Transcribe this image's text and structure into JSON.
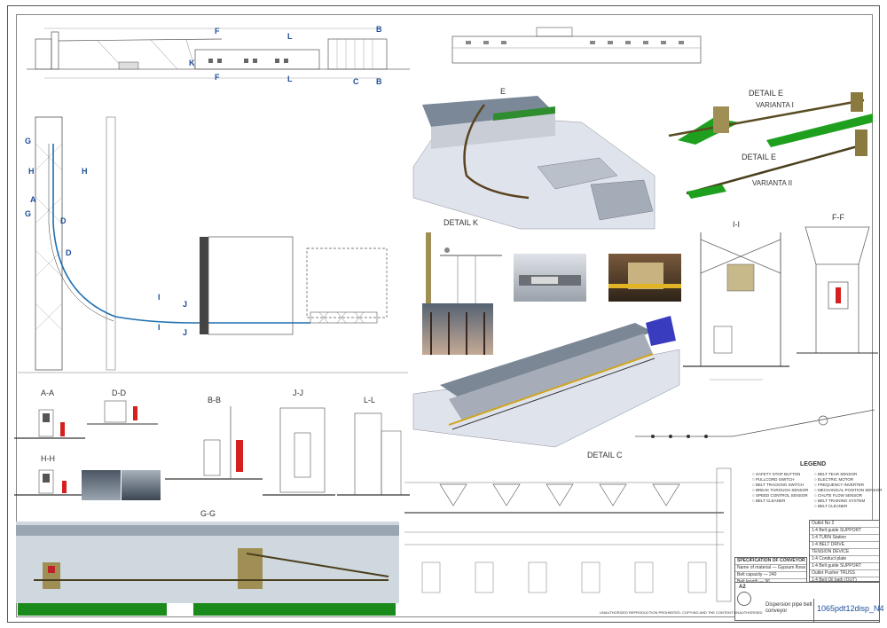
{
  "sheet": {
    "title_line1": "Dispersion pipe belt",
    "title_line2": "conveyor",
    "drawing_no": "1065pdt12disp_N4",
    "sheet_size": "A2"
  },
  "views": {
    "detail_e_3d": "E",
    "detail_e": "DETAIL E",
    "varianta_1": "VARIANTA  I",
    "varianta_2": "VARIANTA  II",
    "detail_e_2": "DETAIL E",
    "detail_k": "DETAIL K",
    "section_ii": "I-I",
    "section_ff": "F-F",
    "section_aa": "A-A",
    "section_dd": "D-D",
    "section_bb": "B-B",
    "section_jj": "J-J",
    "section_ll": "L-L",
    "section_hh": "H-H",
    "section_gg": "G-G",
    "detail_c": "DETAIL C"
  },
  "section_markers": {
    "top_f": "F",
    "top_k": "K",
    "top_l": "L",
    "top_b": "B",
    "top_c": "C",
    "plan_g": "G",
    "plan_h": "H",
    "plan_a": "A",
    "plan_d": "D",
    "plan_i": "I",
    "plan_j": "J"
  },
  "legend": {
    "title": "LEGEND",
    "items_left": [
      "SAFETY STOP BUTTON",
      "PULLCORD SWITCH",
      "BELT TRACKING SWITCH",
      "BREAK THROUGH SENSOR",
      "SPEED CONTROL SENSOR",
      "BELT CLEANER"
    ],
    "items_right": [
      "BELT TEAR SENSOR",
      "ELECTRIC MOTOR",
      "FREQUENCY INVERTER",
      "MECHANICAL POSITION SENSOR",
      "CHUTE FLOW SENSOR",
      "BELT TRAINING SYSTEM",
      "BELT CLEANER"
    ]
  },
  "parts_table": {
    "rows": [
      "Outlet No 2",
      "1:4 Belt guide SUPPORT",
      "1:4 TURN Station",
      "1:4 BELT DRIVE",
      "TENSION DEVICE",
      "1:4 Conduct plate",
      "1:4 Belt guide SUPPORT",
      "Outlet Pusher TRUSS",
      "1:4 Belt Oil bath (OUT)"
    ],
    "footer_left": "Position",
    "footer_right": "Description"
  },
  "spec_table": {
    "title": "SPECIFICATION OF CONVEYOR [SAMPLE]",
    "rows": [
      [
        "Name of material",
        "Gypsum flows"
      ],
      [
        "Belt capacity",
        "240"
      ],
      [
        "Belt length",
        "96"
      ],
      [
        "Belt width",
        "0 / 315"
      ],
      [
        "Temperature",
        "max 80"
      ]
    ]
  },
  "notes": {
    "copyright": "UNAUTHORIZED REPRODUCTION PROHIBITED. COPYING AND THE CONTENT UNAUTHORISED"
  }
}
